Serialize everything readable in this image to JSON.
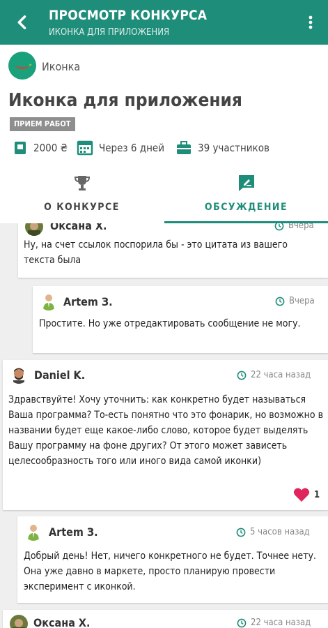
{
  "appbar": {
    "title": "ПРОСМОТР КОНКУРСА",
    "subtitle": "ИКОНКА ДЛЯ ПРИЛОЖЕНИЯ",
    "back_icon": "arrow-left-icon",
    "more_icon": "more-vert-icon"
  },
  "contest": {
    "category": "Иконка",
    "title": "Иконка для приложения",
    "status": "ПРИЕМ РАБОТ",
    "prize": "2000 ₴",
    "deadline": "Через 6 дней",
    "participants": "39 участников"
  },
  "tabs": [
    {
      "label": "О КОНКУРСЕ",
      "icon": "trophy-icon",
      "active": false
    },
    {
      "label": "ОБСУЖДЕНИЕ",
      "icon": "chat-edit-icon",
      "active": true
    }
  ],
  "comments": [
    {
      "author": "Оксана Х.",
      "time": "Вчера",
      "text": "Ну, на счет ссылок поспорила бы - это цитата из вашего текста была"
    },
    {
      "author": "Artem З.",
      "time": "Вчера",
      "text": "Простите. Но уже отредактировать сообщение не могу."
    },
    {
      "author": "Daniel K.",
      "time": "22 часа назад",
      "text": "Здравствуйте! Хочу уточнить: как конкретно будет называться Ваша программа? То-есть понятно что это фонарик, но возможно в названии будет еще какое-либо слово, которое будет выделять Вашу программу на фоне других? От этого может зависеть целесообразность того или иного вида самой иконки)",
      "likes": "1"
    },
    {
      "author": "Artem З.",
      "time": "5 часов назад",
      "text": "Добрый день! Нет, ничего конкретного не будет. Точнее нету. Она уже давно в маркете, просто планирую провести эксперимент с иконкой."
    },
    {
      "author": "Оксана Х.",
      "time": "22 часа назад"
    }
  ],
  "colors": {
    "primary": "#1e8d79",
    "badge": "#8e8e8e",
    "heart": "#e0245e"
  }
}
